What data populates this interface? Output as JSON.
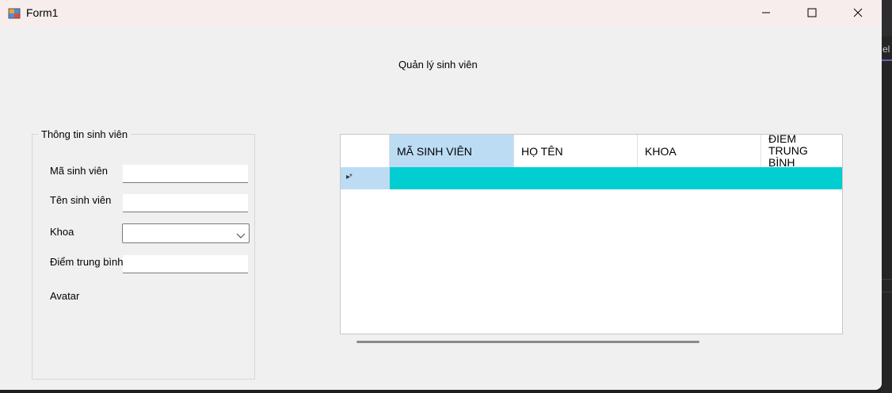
{
  "window": {
    "title": "Form1",
    "icon": "winforms-app-icon",
    "controls": [
      "minimize-icon",
      "maximize-icon",
      "close-icon"
    ]
  },
  "form": {
    "heading": "Quản lý sinh viên"
  },
  "group": {
    "caption": "Thông tin sinh viên",
    "fields": {
      "student_id_label": "Mã sinh viên",
      "student_id_value": "",
      "name_label": "Tên sinh viên",
      "name_value": "",
      "faculty_label": "Khoa",
      "faculty_value": "",
      "gpa_label": "Điểm trung bình",
      "gpa_value": "",
      "avatar_label": "Avatar"
    }
  },
  "grid": {
    "columns": [
      "MÃ SINH VIÊN",
      "HỌ TÊN",
      "KHOA",
      "ĐIỂM TRUNG BÌNH"
    ],
    "new_row_indicator": "▸*",
    "rows": [],
    "selection_color": "#bcdcf4",
    "new_row_color": "#00ced1"
  },
  "background": {
    "partial_text": "el"
  }
}
